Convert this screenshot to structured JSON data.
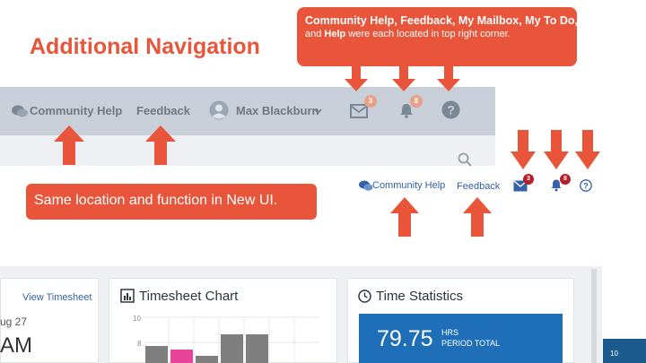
{
  "slide": {
    "title": "Additional Navigation",
    "page_number": "10"
  },
  "callouts": {
    "top_line1": "Community Help, Feedback, My Mailbox, My To Do,",
    "top_line2_pre": "and ",
    "top_line2_bold": "Help",
    "top_line2_post": " were each located in top right corner.",
    "middle": "Same location and function in New UI."
  },
  "old_ui": {
    "community_help": "Community Help",
    "feedback": "Feedback",
    "user_name": "Max Blackburn",
    "mail_count": "3",
    "todo_count": "8"
  },
  "new_ui": {
    "community_help": "Community Help",
    "feedback": "Feedback",
    "mail_count": "3",
    "todo_count": "8"
  },
  "dashboard": {
    "view_timesheet": "View Timesheet",
    "date_fragment": "ug 27",
    "time_fragment": "AM",
    "timesheet_chart_title": "Timesheet Chart",
    "chart_tick_10": "10",
    "chart_tick_8": "8",
    "time_statistics_title": "Time Statistics",
    "stat_value": "79.75",
    "stat_label_1": "HRS",
    "stat_label_2": "PERIOD TOTAL"
  },
  "colors": {
    "accent": "#e8553a",
    "old_bar": "#c8cfd9",
    "new_link": "#3462a8",
    "stat_box": "#1f6fb8",
    "badge": "#b41f2a",
    "pink_bar": "#e8449a",
    "gray_bar": "#7f7f7f"
  }
}
